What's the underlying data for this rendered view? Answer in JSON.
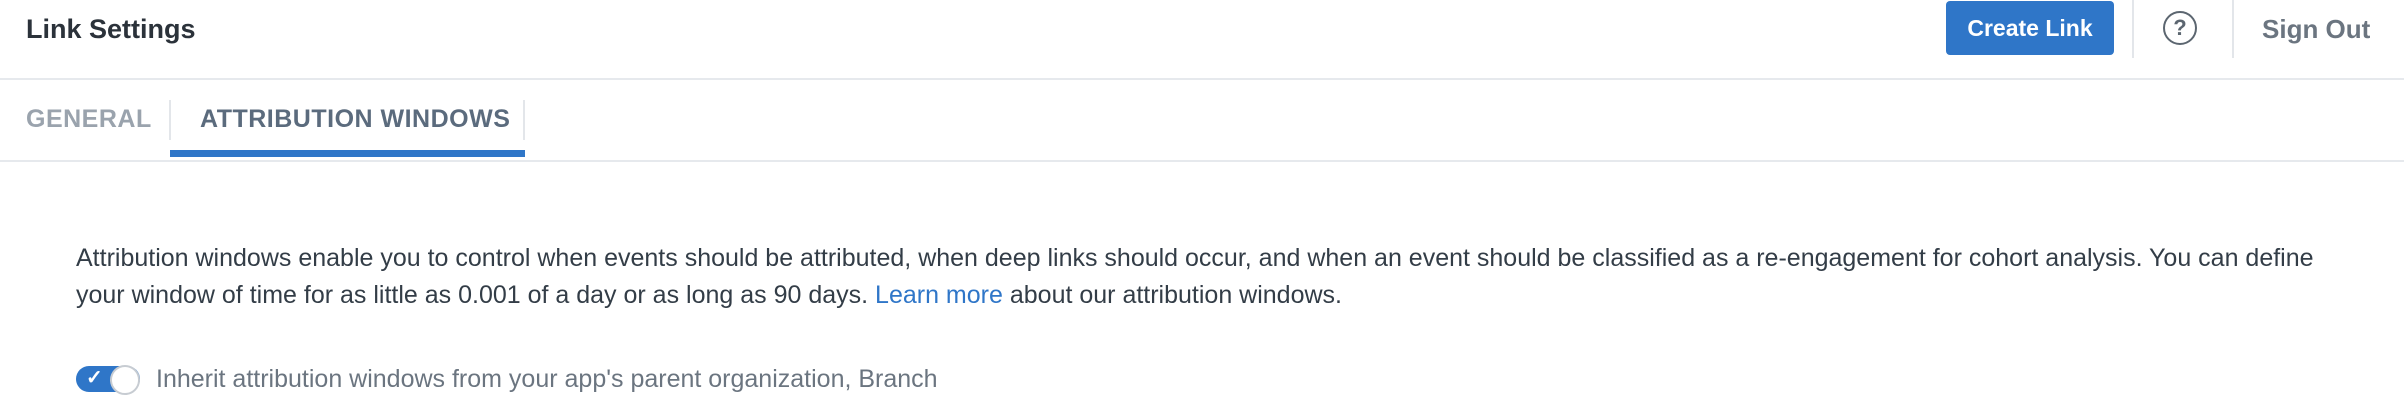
{
  "header": {
    "title": "Link Settings",
    "create_link_label": "Create Link",
    "help_icon": "question-circle-icon",
    "help_glyph": "?",
    "sign_out_label": "Sign Out"
  },
  "tabs": [
    {
      "label": "GENERAL",
      "active": false
    },
    {
      "label": "ATTRIBUTION WINDOWS",
      "active": true
    }
  ],
  "content": {
    "description_before_link": "Attribution windows enable you to control when events should be attributed, when deep links should occur, and when an event should be classified as a re-engagement for cohort analysis. You can define your window of time for as little as 0.001 of a day or as long as 90 days. ",
    "learn_more_label": "Learn more",
    "description_after_link": " about our attribution windows.",
    "inherit_toggle": {
      "checked": true,
      "check_glyph": "✓",
      "label": "Inherit attribution windows from your app's parent organization, Branch"
    }
  },
  "colors": {
    "accent": "#2f76c8",
    "text": "#333d47",
    "muted": "#9aa3ad"
  }
}
